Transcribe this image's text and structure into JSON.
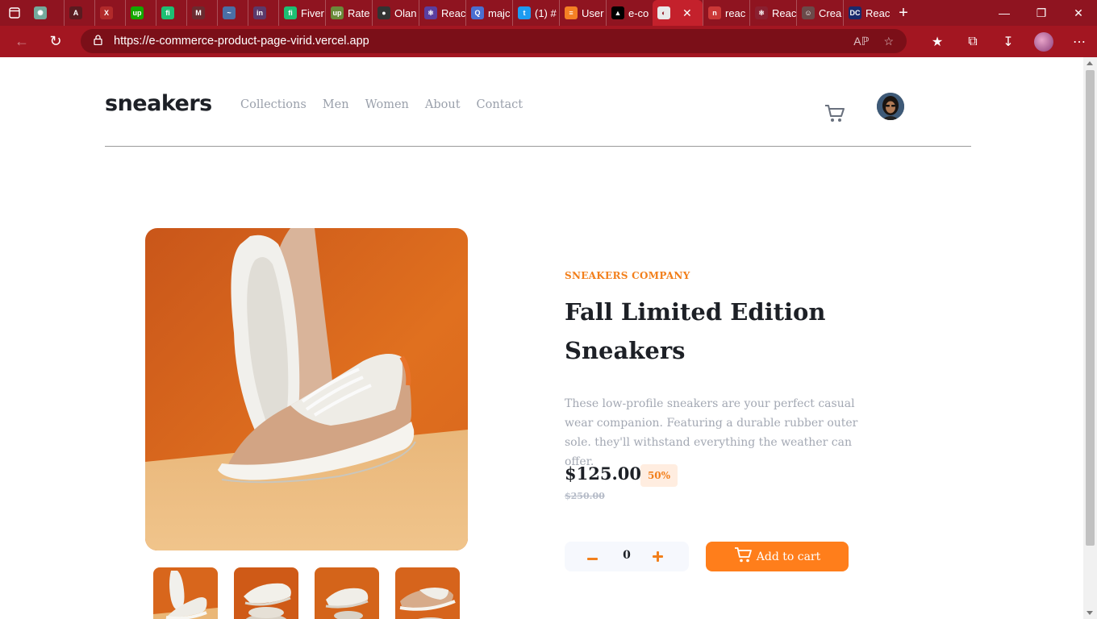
{
  "browser": {
    "tabs": [
      {
        "label": "",
        "icon": "chatgpt-icon",
        "color": "#74aa9c"
      },
      {
        "label": "",
        "icon": "angular-icon",
        "color": "#5a1b20"
      },
      {
        "label": "",
        "icon": "x-mark-icon",
        "color": "#b22a2a"
      },
      {
        "label": "",
        "icon": "upwork-icon",
        "color": "#14a800"
      },
      {
        "label": "",
        "icon": "fiverr-icon",
        "color": "#1dbf73"
      },
      {
        "label": "",
        "icon": "medium-icon",
        "color": "#6b2b30"
      },
      {
        "label": "",
        "icon": "tailwind-icon",
        "color": "#4a6fa5"
      },
      {
        "label": "",
        "icon": "linkedin-icon",
        "color": "#5b3a6b"
      },
      {
        "label": "Fiver",
        "icon": "fiverr-icon",
        "color": "#1dbf73"
      },
      {
        "label": "Rate",
        "icon": "upwork-icon",
        "color": "#6a8a3a"
      },
      {
        "label": "Olan",
        "icon": "github-icon",
        "color": "#333333"
      },
      {
        "label": "Reac",
        "icon": "redux-icon",
        "color": "#5a3fa0"
      },
      {
        "label": "majc",
        "icon": "search-icon",
        "color": "#4a6fd0"
      },
      {
        "label": "(1) #",
        "icon": "twitter-icon",
        "color": "#1d9bf0"
      },
      {
        "label": "User",
        "icon": "stackoverflow-icon",
        "color": "#f48024"
      },
      {
        "label": "e-co",
        "icon": "vercel-icon",
        "color": "#000000"
      },
      {
        "label": "",
        "icon": "page-icon",
        "color": "#e9e9e9",
        "active": true
      },
      {
        "label": "reac",
        "icon": "npm-icon",
        "color": "#cb3837"
      },
      {
        "label": "Reac",
        "icon": "react-icon",
        "color": "#8a2030"
      },
      {
        "label": "Crea",
        "icon": "profile-icon",
        "color": "#6b4a4a"
      },
      {
        "label": "Reac",
        "icon": "dc-icon",
        "color": "#1a2a6c"
      }
    ],
    "url": "https://e-commerce-product-page-virid.vercel.app"
  },
  "site": {
    "logo": "sneakers",
    "nav": [
      "Collections",
      "Men",
      "Women",
      "About",
      "Contact"
    ]
  },
  "product": {
    "company": "SNEAKERS COMPANY",
    "title": "Fall Limited Edition Sneakers",
    "description": "These low-profile sneakers are your perfect casual wear companion. Featuring a durable rubber outer sole. they'll withstand everything the weather can offer.",
    "price": "$125.00",
    "discount": "50%",
    "original_price": "$250.00",
    "quantity": "0",
    "add_to_cart": "Add to cart"
  },
  "colors": {
    "accent": "#ff7e1b",
    "accent_light": "#ffede0",
    "dark": "#1d2026",
    "muted": "#a3a8b3",
    "browser_frame": "#8f1420"
  }
}
